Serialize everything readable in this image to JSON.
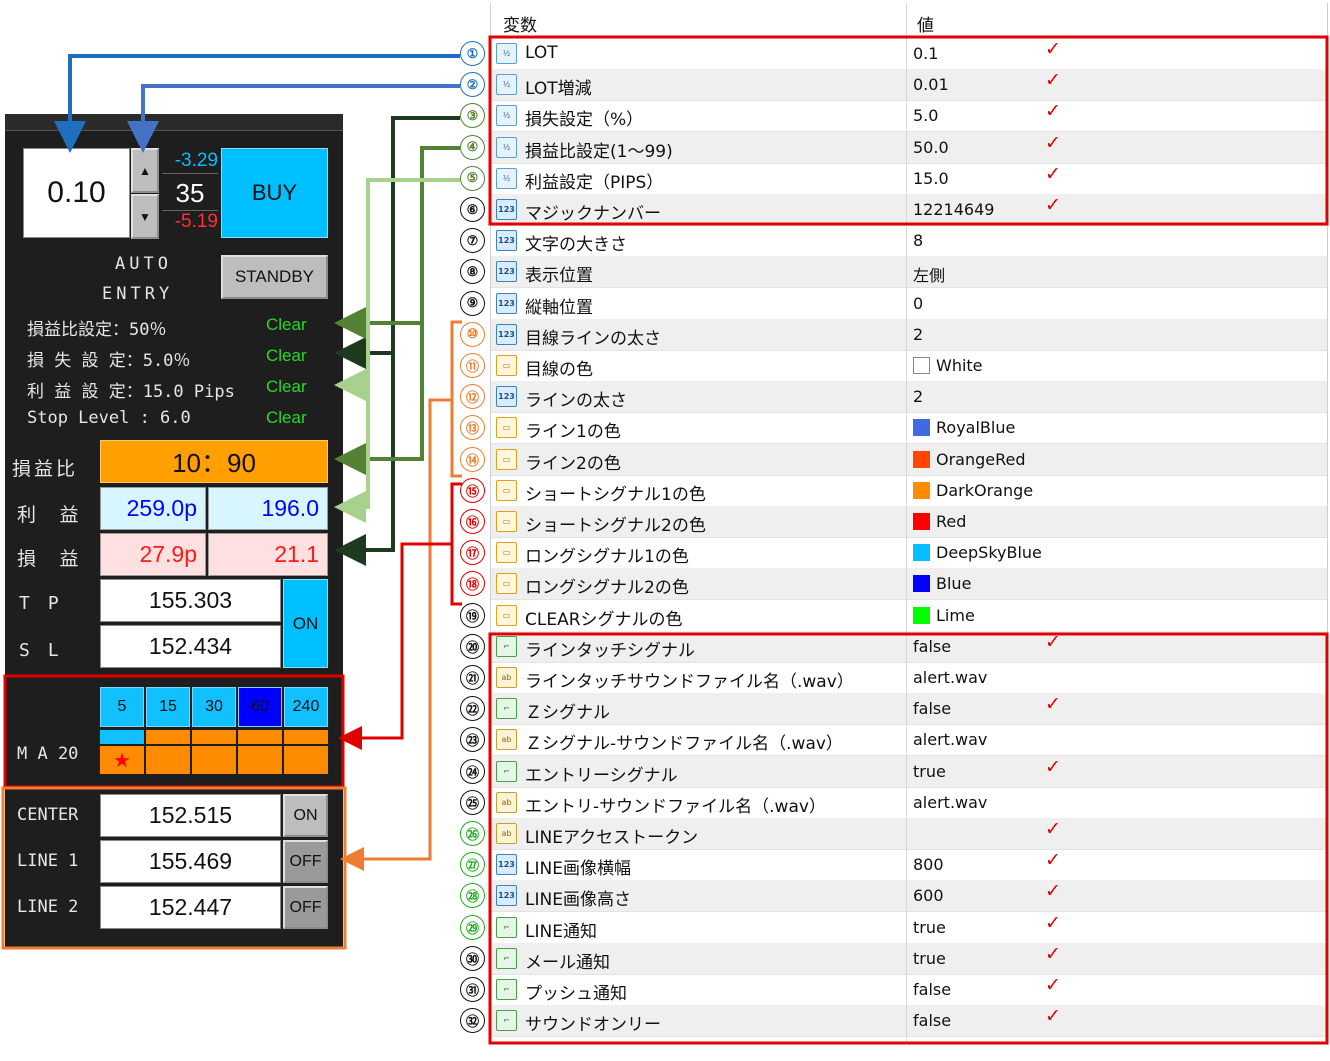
{
  "panel": {
    "lot_value": "0.10",
    "up_value": "-3.29",
    "mid_value": "35",
    "down_value": "-5.19",
    "buy_label": "BUY",
    "auto_label": "AUTO",
    "entry_label": "ENTRY",
    "standby_label": "STANDBY",
    "settings": [
      {
        "label": "損益比設定：50％",
        "status": "Clear"
      },
      {
        "label": "損 失 設 定：5.0％",
        "status": "Clear"
      },
      {
        "label": "利 益 設 定：15.0 Pips",
        "status": "Clear"
      },
      {
        "label": "Stop Level : 6.0",
        "status": "Clear"
      }
    ],
    "ratio_label": "損益比",
    "ratio_value": "10：90",
    "profit_label": "利 益",
    "profit_pips": "259.0p",
    "profit_amount": "196.0",
    "loss_label": "損 益",
    "loss_pips": "27.9p",
    "loss_amount": "21.1",
    "tp_label": "T　P",
    "tp_value": "155.303",
    "sl_label": "S　L",
    "sl_value": "152.434",
    "tpsl_toggle": "ON",
    "ma_label": "M A 20",
    "ma_periods": [
      "5",
      "15",
      "30",
      "60",
      "240"
    ],
    "ma_selected": "60",
    "ma_star": "★",
    "center_label": "CENTER",
    "center_value": "152.515",
    "center_toggle": "ON",
    "line1_label": "LINE 1",
    "line1_value": "155.469",
    "line1_toggle": "OFF",
    "line2_label": "LINE 2",
    "line2_value": "152.447",
    "line2_toggle": "OFF"
  },
  "table": {
    "col_variable": "変数",
    "col_value": "値",
    "rows": [
      {
        "num": "①",
        "icon": "dbl",
        "name": "LOT",
        "value": "0.1",
        "check": "✓"
      },
      {
        "num": "②",
        "icon": "dbl",
        "name": "LOT増減",
        "value": "0.01",
        "check": "✓"
      },
      {
        "num": "③",
        "icon": "dbl",
        "name": "損失設定（%）",
        "value": "5.0",
        "check": "✓"
      },
      {
        "num": "④",
        "icon": "dbl",
        "name": "損益比設定(1～99)",
        "value": "50.0",
        "check": "✓"
      },
      {
        "num": "⑤",
        "icon": "dbl",
        "name": "利益設定（PIPS）",
        "value": "15.0",
        "check": "✓"
      },
      {
        "num": "⑥",
        "icon": "int",
        "name": "マジックナンバー",
        "value": "12214649",
        "check": "✓"
      },
      {
        "num": "⑦",
        "icon": "int",
        "name": "文字の大きさ",
        "value": "8",
        "check": ""
      },
      {
        "num": "⑧",
        "icon": "int",
        "name": "表示位置",
        "value": "左側",
        "check": ""
      },
      {
        "num": "⑨",
        "icon": "int",
        "name": "縦軸位置",
        "value": "0",
        "check": ""
      },
      {
        "num": "⑩",
        "icon": "int",
        "name": "目線ラインの太さ",
        "value": "2",
        "check": ""
      },
      {
        "num": "⑪",
        "icon": "col",
        "name": "目線の色",
        "value": "White",
        "swatch": "#ffffff",
        "check": ""
      },
      {
        "num": "⑫",
        "icon": "int",
        "name": "ラインの太さ",
        "value": "2",
        "check": ""
      },
      {
        "num": "⑬",
        "icon": "col",
        "name": "ライン1の色",
        "value": "RoyalBlue",
        "swatch": "#4169e1",
        "check": ""
      },
      {
        "num": "⑭",
        "icon": "col",
        "name": "ライン2の色",
        "value": "OrangeRed",
        "swatch": "#ff4500",
        "check": ""
      },
      {
        "num": "⑮",
        "icon": "col",
        "name": "ショートシグナル1の色",
        "value": "DarkOrange",
        "swatch": "#ff8c00",
        "check": ""
      },
      {
        "num": "⑯",
        "icon": "col",
        "name": "ショートシグナル2の色",
        "value": "Red",
        "swatch": "#ff0000",
        "check": ""
      },
      {
        "num": "⑰",
        "icon": "col",
        "name": "ロングシグナル1の色",
        "value": "DeepSkyBlue",
        "swatch": "#00bfff",
        "check": ""
      },
      {
        "num": "⑱",
        "icon": "col",
        "name": "ロングシグナル2の色",
        "value": "Blue",
        "swatch": "#0000ff",
        "check": ""
      },
      {
        "num": "⑲",
        "icon": "col",
        "name": "CLEARシグナルの色",
        "value": "Lime",
        "swatch": "#00ff00",
        "check": ""
      },
      {
        "num": "⑳",
        "icon": "bool",
        "name": "ラインタッチシグナル",
        "value": "false",
        "check": "✓"
      },
      {
        "num": "㉑",
        "icon": "str",
        "name": "ラインタッチサウンドファイル名（.wav）",
        "value": "alert.wav",
        "check": ""
      },
      {
        "num": "㉒",
        "icon": "bool",
        "name": "Ｚシグナル",
        "value": "false",
        "check": "✓"
      },
      {
        "num": "㉓",
        "icon": "str",
        "name": "Ｚシグナル-サウンドファイル名（.wav）",
        "value": "alert.wav",
        "check": ""
      },
      {
        "num": "㉔",
        "icon": "bool",
        "name": "エントリーシグナル",
        "value": "true",
        "check": "✓"
      },
      {
        "num": "㉕",
        "icon": "str",
        "name": "エントリ-サウンドファイル名（.wav）",
        "value": "alert.wav",
        "check": ""
      },
      {
        "num": "㉖",
        "icon": "str",
        "name": "LINEアクセストークン",
        "value": "",
        "check": "✓"
      },
      {
        "num": "㉗",
        "icon": "int",
        "name": "LINE画像横幅",
        "value": "800",
        "check": "✓"
      },
      {
        "num": "㉘",
        "icon": "int",
        "name": "LINE画像高さ",
        "value": "600",
        "check": "✓"
      },
      {
        "num": "㉙",
        "icon": "bool",
        "name": "LINE通知",
        "value": "true",
        "check": "✓"
      },
      {
        "num": "㉚",
        "icon": "bool",
        "name": "メール通知",
        "value": "true",
        "check": "✓"
      },
      {
        "num": "㉛",
        "icon": "bool",
        "name": "プッシュ通知",
        "value": "false",
        "check": "✓"
      },
      {
        "num": "㉜",
        "icon": "bool",
        "name": "サウンドオンリー",
        "value": "false",
        "check": "✓"
      }
    ]
  },
  "colors": {
    "callout_blue": "#1f6fc0",
    "callout_green_dark": "#1e3a1e",
    "callout_green": "#548235",
    "callout_green_light": "#a9d18e",
    "callout_orange": "#ed7d31",
    "callout_red": "#e00000",
    "ratio_bg": "#ff9f00",
    "check_red": "#e00000"
  }
}
